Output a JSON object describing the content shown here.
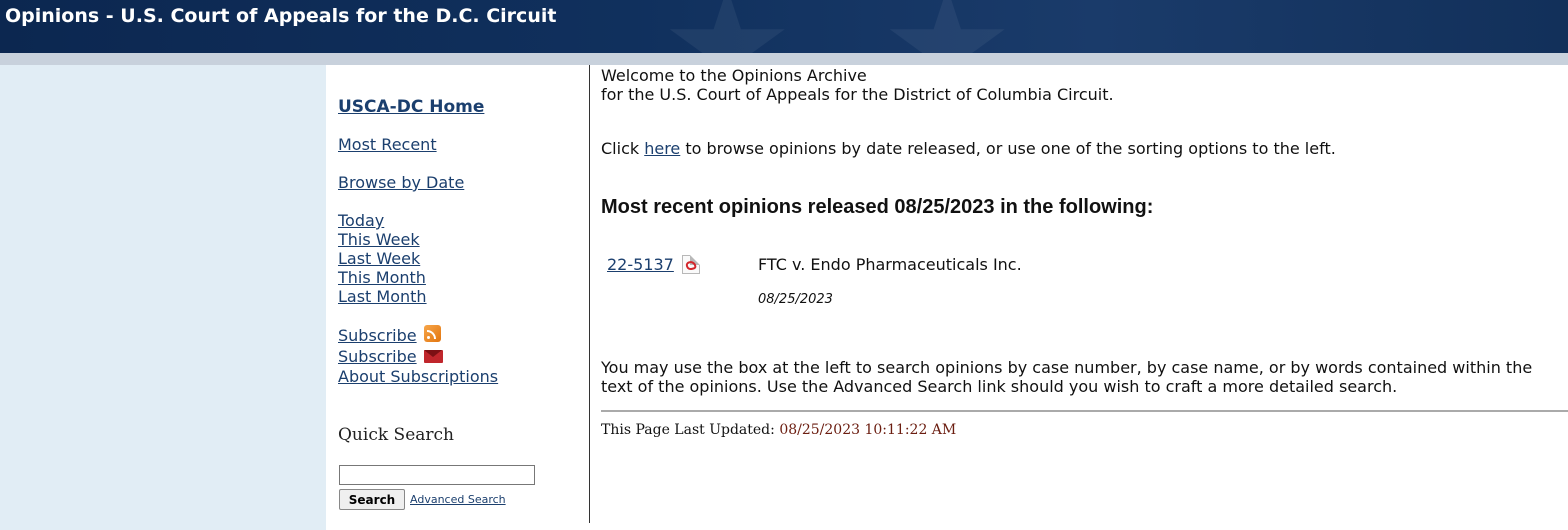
{
  "header": {
    "title": "Opinions - U.S. Court of Appeals for the D.C. Circuit"
  },
  "sidebar": {
    "home": "USCA-DC Home",
    "most_recent": "Most Recent",
    "browse_by_date": "Browse by Date",
    "period_links": [
      "Today",
      "This Week",
      "Last Week",
      "This Month",
      "Last Month"
    ],
    "subscribe_rss": "Subscribe",
    "subscribe_email": "Subscribe",
    "about_subscriptions": "About Subscriptions"
  },
  "quick_search": {
    "title": "Quick Search",
    "input_value": "",
    "button_label": "Search",
    "advanced_link": "Advanced Search"
  },
  "main": {
    "welcome_line1": "Welcome to the Opinions Archive",
    "welcome_line2": "for the U.S. Court of Appeals for the District of Columbia Circuit.",
    "browse_prefix": "Click ",
    "browse_link": "here",
    "browse_suffix": " to browse opinions by date released, or use one of the sorting options to the left.",
    "recent_heading": "Most recent opinions released 08/25/2023 in the following:",
    "opinions": [
      {
        "case_number": "22-5137",
        "case_name": "FTC v. Endo Pharmaceuticals Inc.",
        "date": "08/25/2023"
      }
    ],
    "search_help_line1": "You may use the box at the left to search opinions by case number, by case name, or by words contained within the",
    "search_help_line2": "text of the opinions. Use the Advanced Search link should you wish to craft a more detailed search."
  },
  "footer": {
    "last_updated_label": "This Page Last Updated:",
    "last_updated_value": "08/25/2023 10:11:22 AM"
  },
  "icons": {
    "rss": "rss-feed-icon",
    "email": "email-subscribe-icon",
    "pdf": "pdf-document-icon"
  },
  "colors": {
    "header_bg": "#10305d",
    "link": "#1b3f6e",
    "left_gutter": "#e1edf5",
    "timestamp": "#6b1d10"
  }
}
